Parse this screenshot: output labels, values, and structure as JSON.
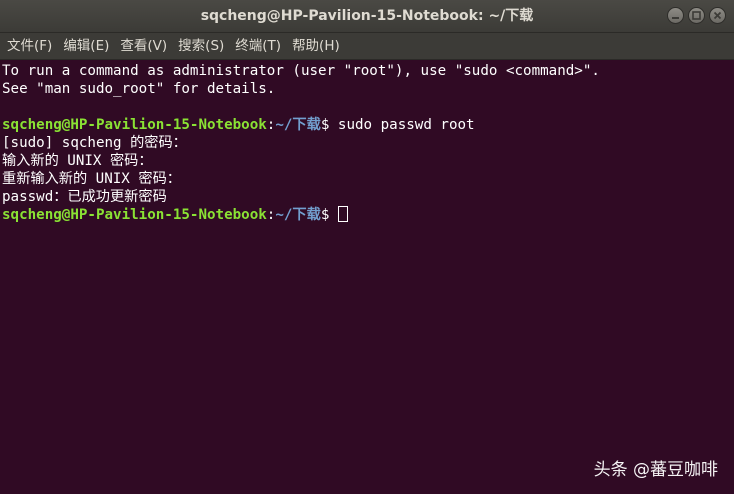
{
  "window": {
    "title": "sqcheng@HP-Pavilion-15-Notebook: ~/下载"
  },
  "menu": {
    "items": [
      {
        "label": "文件(F)"
      },
      {
        "label": "编辑(E)"
      },
      {
        "label": "查看(V)"
      },
      {
        "label": "搜索(S)"
      },
      {
        "label": "终端(T)"
      },
      {
        "label": "帮助(H)"
      }
    ]
  },
  "terminal": {
    "line1": "To run a command as administrator (user \"root\"), use \"sudo <command>\".",
    "line2": "See \"man sudo_root\" for details.",
    "prompt_user": "sqcheng@HP-Pavilion-15-Notebook",
    "prompt_sep": ":",
    "prompt_path": "~/下载",
    "prompt_dollar": "$ ",
    "command1": "sudo passwd root",
    "out1": "[sudo] sqcheng 的密码：",
    "out2": "输入新的 UNIX 密码：",
    "out3": "重新输入新的 UNIX 密码：",
    "out4": "passwd：已成功更新密码"
  },
  "watermark": {
    "text": "头条 @蕃豆咖啡"
  },
  "colors": {
    "background": "#300a24",
    "prompt_user": "#8ae234",
    "prompt_path": "#729fcf",
    "text": "#ffffff"
  }
}
